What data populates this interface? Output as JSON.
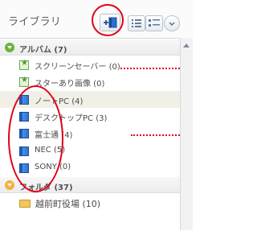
{
  "header": {
    "title": "ライブラリ"
  },
  "groups": {
    "albums": {
      "label": "アルバム (7)"
    },
    "folders": {
      "label": "フォルダ (37)"
    }
  },
  "items": [
    {
      "label": "スクリーンセーバー (0)",
      "icon": "star-album-icon"
    },
    {
      "label": "スターあり画像 (0)",
      "icon": "star-album-icon"
    },
    {
      "label": "ノートPC (4)",
      "icon": "album-icon"
    },
    {
      "label": "デスクトップPC (3)",
      "icon": "album-icon"
    },
    {
      "label": "富士通 (4)",
      "icon": "album-icon"
    },
    {
      "label": "NEC (5)",
      "icon": "album-icon"
    },
    {
      "label": "SONY (0)",
      "icon": "album-icon"
    }
  ],
  "folder_items": [
    {
      "label": "越前町役場 (10)",
      "icon": "folder-icon"
    }
  ],
  "colors": {
    "annotation_red": "#e0001b",
    "album_green": "#6cb23f",
    "folder_orange": "#f4b23a"
  }
}
